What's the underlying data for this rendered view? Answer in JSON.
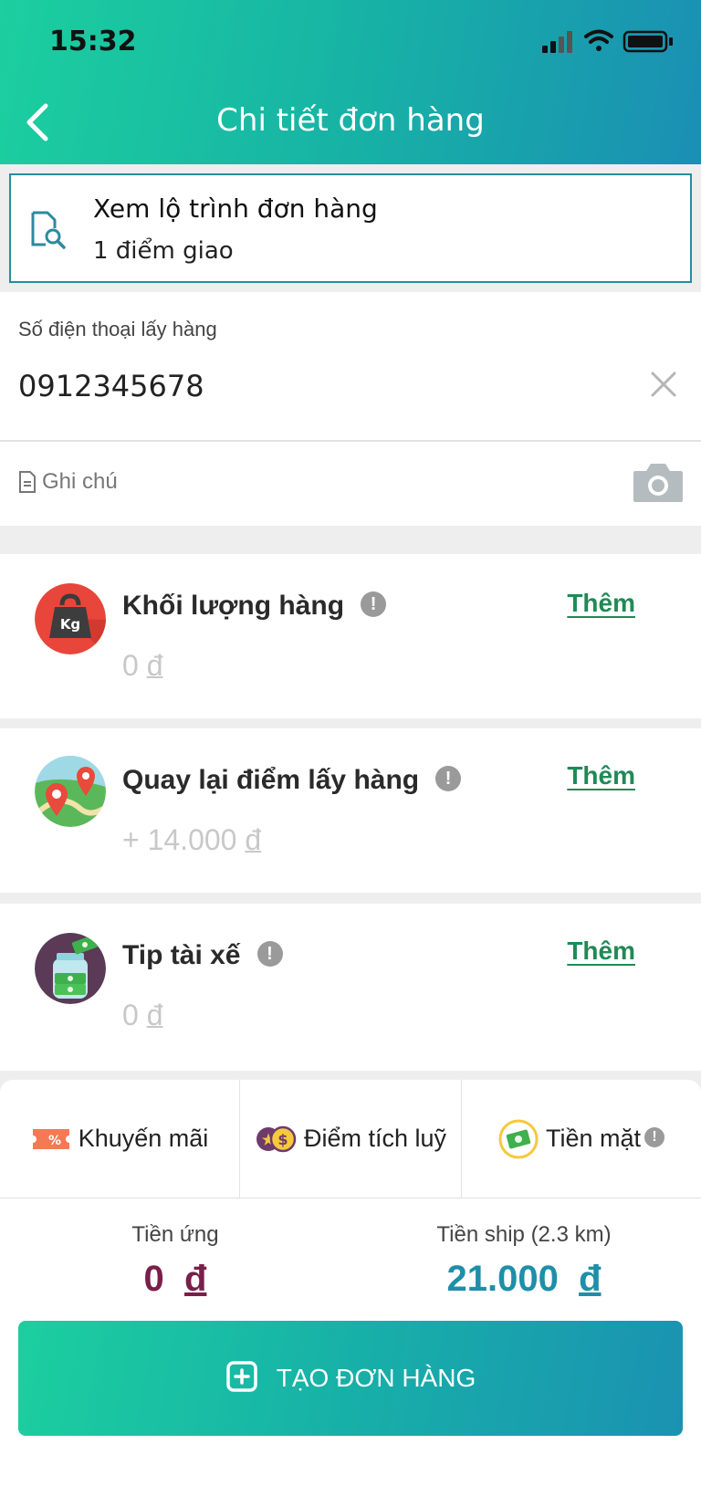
{
  "status_bar": {
    "time": "15:32"
  },
  "header": {
    "title": "Chi tiết đơn hàng"
  },
  "route": {
    "title": "Xem lộ trình đơn hàng",
    "subtitle": "1 điểm giao"
  },
  "pickup_phone": {
    "label": "Số điện thoại lấy hàng",
    "value": "0912345678"
  },
  "note": {
    "label": "Ghi chú"
  },
  "services": [
    {
      "title": "Khối lượng hàng",
      "price_prefix": "",
      "price": "0",
      "currency": "đ",
      "action": "Thêm"
    },
    {
      "title": "Quay lại điểm lấy hàng",
      "price_prefix": "+ ",
      "price": "14.000",
      "currency": "đ",
      "action": "Thêm"
    },
    {
      "title": "Tip tài xế",
      "price_prefix": "",
      "price": "0",
      "currency": "đ",
      "action": "Thêm"
    }
  ],
  "options": {
    "promo": "Khuyến mãi",
    "points": "Điểm tích luỹ",
    "payment": "Tiền mặt"
  },
  "summary": {
    "advance_label": "Tiền ứng",
    "advance_value": "0",
    "advance_currency": "đ",
    "ship_label": "Tiền ship (2.3 km)",
    "ship_value": "21.000",
    "ship_currency": "đ"
  },
  "create_button": {
    "label": "TẠO ĐƠN HÀNG"
  },
  "colors": {
    "accent": "#1ab3a8",
    "link_green": "#1f8a55",
    "advance": "#7a1f4a",
    "ship": "#1e8fa8"
  }
}
